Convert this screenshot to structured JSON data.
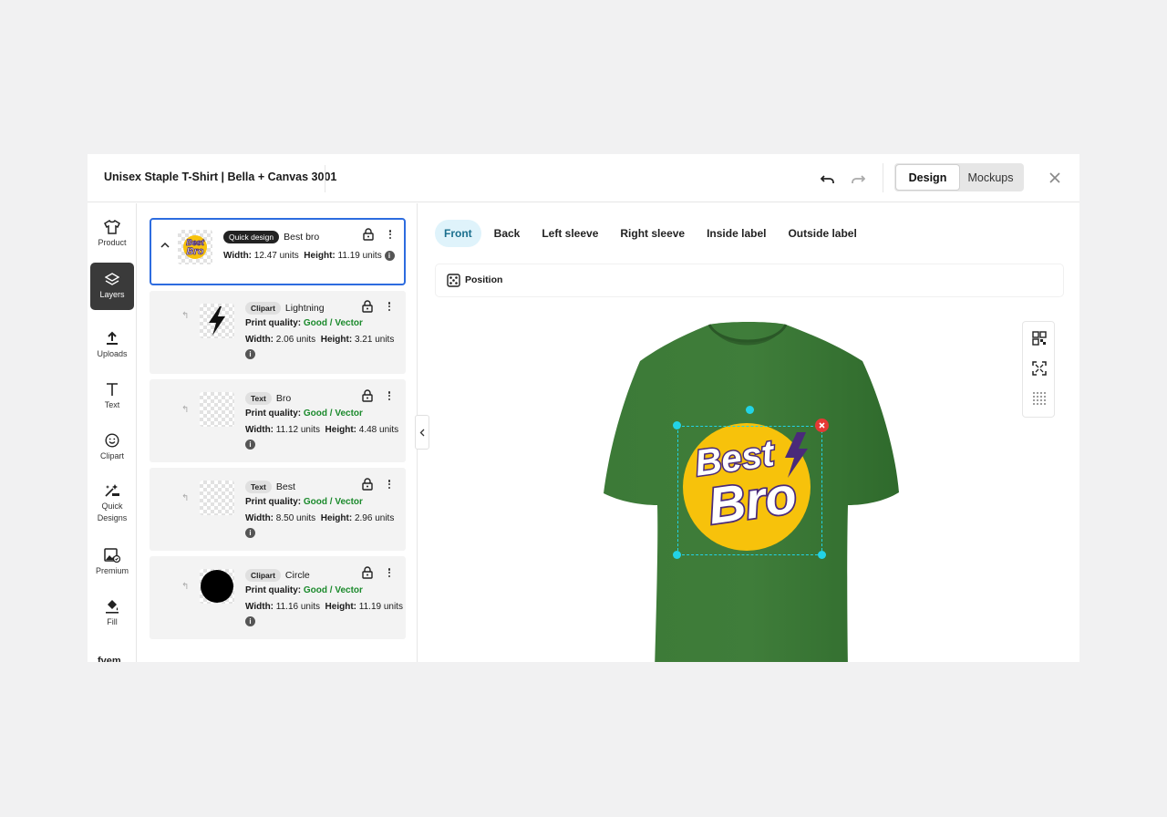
{
  "header": {
    "title": "Unisex Staple T-Shirt | Bella + Canvas 3001",
    "undo_icon": "undo-icon",
    "redo_icon": "redo-icon",
    "mode_tabs": [
      "Design",
      "Mockups"
    ],
    "active_mode": "Design",
    "close_icon": "close-icon"
  },
  "rail": {
    "items": [
      {
        "label": "Product",
        "icon": "tshirt-icon"
      },
      {
        "label": "Layers",
        "icon": "layers-icon",
        "active": true
      },
      {
        "label": "Uploads",
        "icon": "upload-icon"
      },
      {
        "label": "Text",
        "icon": "text-icon"
      },
      {
        "label": "Clipart",
        "icon": "smiley-icon"
      },
      {
        "label": "Quick Designs",
        "icon": "sparkle-icon"
      },
      {
        "label": "Premium",
        "icon": "premium-image-icon"
      },
      {
        "label": "Fill",
        "icon": "paint-bucket-icon"
      }
    ],
    "cut_text": "fvem"
  },
  "layers": {
    "group": {
      "tag": "Quick design",
      "name": "Best bro",
      "width_label": "Width:",
      "width_value": "12.47 units",
      "height_label": "Height:",
      "height_value": "11.19 units"
    },
    "children": [
      {
        "tag": "Clipart",
        "name": "Lightning",
        "quality_label": "Print quality:",
        "quality_value": "Good / Vector",
        "width_label": "Width:",
        "width_value": "2.06 units",
        "height_label": "Height:",
        "height_value": "3.21 units"
      },
      {
        "tag": "Text",
        "name": "Bro",
        "quality_label": "Print quality:",
        "quality_value": "Good / Vector",
        "width_label": "Width:",
        "width_value": "11.12 units",
        "height_label": "Height:",
        "height_value": "4.48 units"
      },
      {
        "tag": "Text",
        "name": "Best",
        "quality_label": "Print quality:",
        "quality_value": "Good / Vector",
        "width_label": "Width:",
        "width_value": "8.50 units",
        "height_label": "Height:",
        "height_value": "2.96 units"
      },
      {
        "tag": "Clipart",
        "name": "Circle",
        "quality_label": "Print quality:",
        "quality_value": "Good / Vector",
        "width_label": "Width:",
        "width_value": "11.16 units",
        "height_label": "Height:",
        "height_value": "11.19 units"
      }
    ]
  },
  "placement_tabs": [
    "Front",
    "Back",
    "Left sleeve",
    "Right sleeve",
    "Inside label",
    "Outside label"
  ],
  "active_placement": "Front",
  "position_label": "Position",
  "design_text": {
    "line1": "Best",
    "line2": "Bro"
  },
  "colors": {
    "accent_blue": "#2d6cdf",
    "good_green": "#1b8a2c",
    "shirt_green": "#3f7d3a",
    "circle_yellow": "#f7c20b",
    "text_purple": "#4a2a7a",
    "handle_cyan": "#22d3e6"
  }
}
